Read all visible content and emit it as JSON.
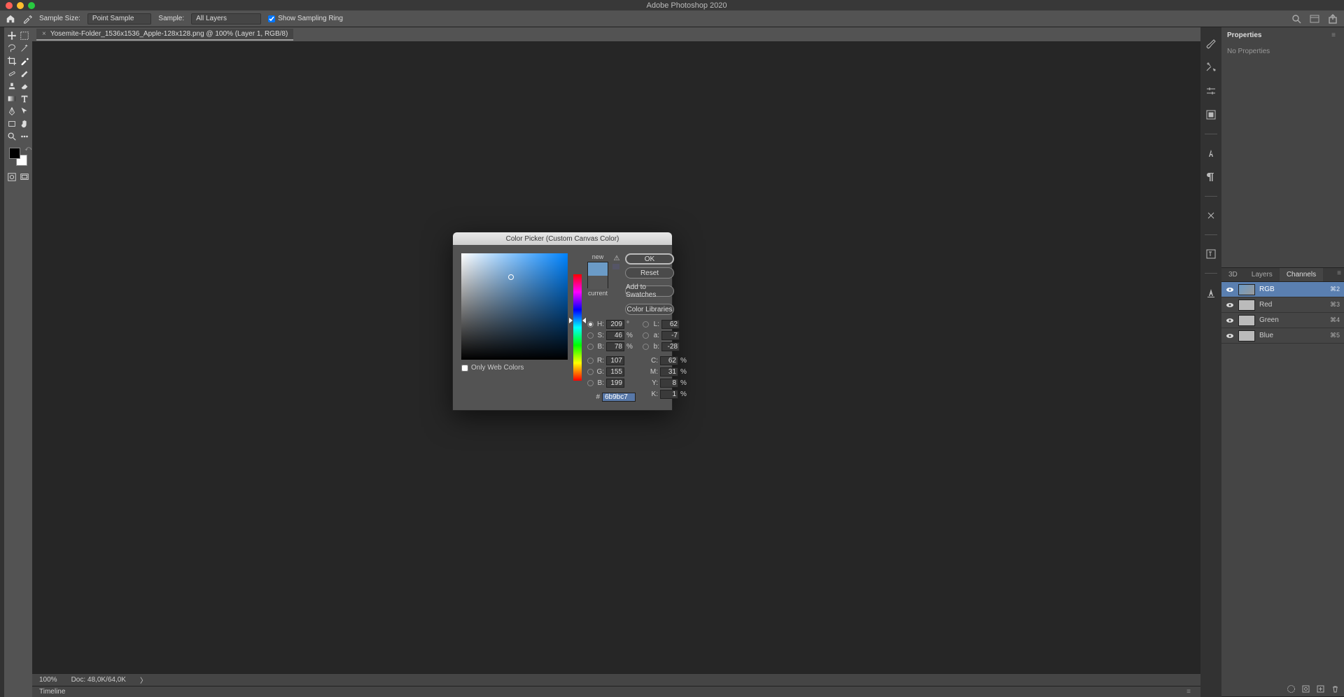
{
  "app_title": "Adobe Photoshop 2020",
  "options": {
    "sample_size_label": "Sample Size:",
    "sample_size_value": "Point Sample",
    "sample_label": "Sample:",
    "sample_value": "All Layers",
    "show_ring_label": "Show Sampling Ring"
  },
  "doc_tab": "Yosemite-Folder_1536x1536_Apple-128x128.png @ 100% (Layer 1, RGB/8)",
  "status": {
    "zoom": "100%",
    "doc": "Doc: 48,0K/64,0K"
  },
  "timeline_label": "Timeline",
  "properties": {
    "title": "Properties",
    "empty": "No Properties"
  },
  "panel_tabs": {
    "td": "3D",
    "layers": "Layers",
    "channels": "Channels"
  },
  "channels": [
    {
      "name": "RGB",
      "key": "⌘2"
    },
    {
      "name": "Red",
      "key": "⌘3"
    },
    {
      "name": "Green",
      "key": "⌘4"
    },
    {
      "name": "Blue",
      "key": "⌘5"
    }
  ],
  "picker": {
    "title": "Color Picker (Custom Canvas Color)",
    "new_label": "new",
    "current_label": "current",
    "ok": "OK",
    "reset": "Reset",
    "add_swatches": "Add to Swatches",
    "color_libs": "Color Libraries",
    "only_web": "Only Web Colors",
    "H": "209",
    "S": "46",
    "Bv": "78",
    "L": "62",
    "a": "-7",
    "b": "-28",
    "R": "107",
    "G": "155",
    "Bl": "199",
    "C": "62",
    "M": "31",
    "Y": "8",
    "K": "1",
    "hex": "6b9bc7",
    "deg": "°",
    "pct": "%",
    "lbl": {
      "H": "H:",
      "S": "S:",
      "B": "B:",
      "L": "L:",
      "a": "a:",
      "b": "b:",
      "R": "R:",
      "G": "G:",
      "Bl": "B:",
      "C": "C:",
      "M": "M:",
      "Y": "Y:",
      "K": "K:",
      "hash": "#"
    }
  }
}
